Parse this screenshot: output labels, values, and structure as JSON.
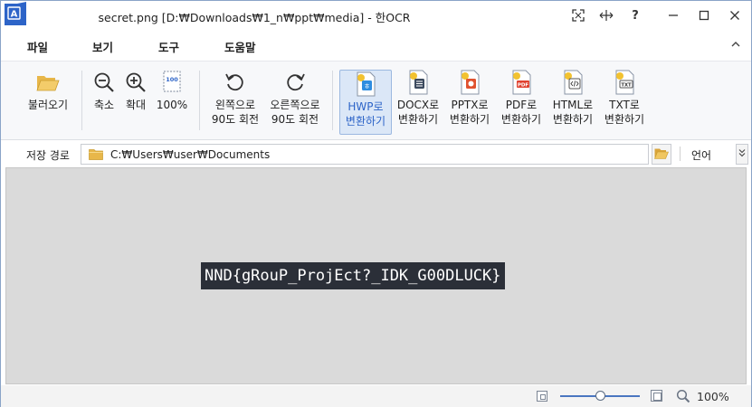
{
  "window": {
    "title": "secret.png  [D:₩Downloads₩1_n₩ppt₩media] - 한OCR"
  },
  "titlebar": {
    "buttons": [
      "fullscreen-icon",
      "move-icon",
      "help-icon",
      "minimize-icon",
      "maximize-icon",
      "close-icon"
    ],
    "help_label": "?"
  },
  "menu": {
    "items": [
      "파일",
      "보기",
      "도구",
      "도움말"
    ],
    "collapse_label": "^"
  },
  "ribbon": {
    "open": {
      "line1": "불러오기"
    },
    "zoom_out": {
      "line1": "축소"
    },
    "zoom_in": {
      "line1": "확대"
    },
    "zoom_100": {
      "line1": "100%",
      "badge": "100"
    },
    "rotate_left": {
      "line1": "왼쪽으로",
      "line2": "90도 회전"
    },
    "rotate_right": {
      "line1": "오른쪽으로",
      "line2": "90도 회전"
    },
    "to_hwp": {
      "line1": "HWP로",
      "line2": "변환하기"
    },
    "to_docx": {
      "line1": "DOCX로",
      "line2": "변환하기"
    },
    "to_pptx": {
      "line1": "PPTX로",
      "line2": "변환하기"
    },
    "to_pdf": {
      "line1": "PDF로",
      "line2": "변환하기",
      "badge": "PDF"
    },
    "to_html": {
      "line1": "HTML로",
      "line2": "변환하기"
    },
    "to_txt": {
      "line1": "TXT로",
      "line2": "변환하기",
      "badge": "TXT"
    }
  },
  "pathbar": {
    "label": "저장 경로",
    "value": "C:₩Users₩user₩Documents",
    "language_label": "언어"
  },
  "canvas": {
    "image_text": "NND{gRouP_ProjEct?_IDK_G00DLUCK}"
  },
  "statusbar": {
    "zoom_value": "100%",
    "zoom_slider_level": 0.5
  },
  "colors": {
    "accent": "#4a76c0",
    "active_button_bg": "#dbe7f7",
    "canvas_bg": "#dadada",
    "image_bg": "#2b2f38"
  }
}
